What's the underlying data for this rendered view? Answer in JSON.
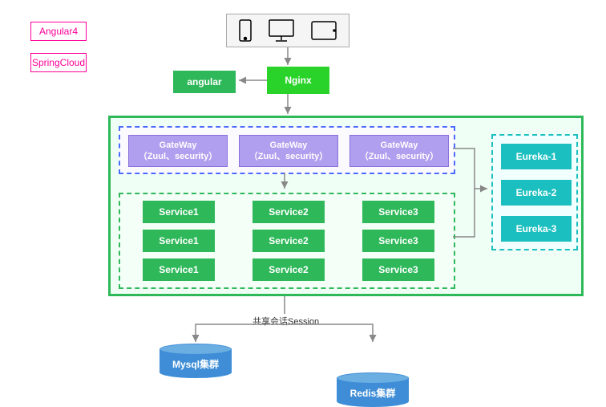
{
  "legend": {
    "angular4": "Angular4",
    "spring": "SpringCloud"
  },
  "top": {
    "angular": "angular",
    "nginx": "Nginx"
  },
  "container": {
    "gateway": {
      "label": "GateWay",
      "sublabel": "（Zuul、security）"
    },
    "services": {
      "s1": "Service1",
      "s2": "Service2",
      "s3": "Service3"
    },
    "eureka": {
      "e1": "Eureka-1",
      "e2": "Eureka-2",
      "e3": "Eureka-3"
    }
  },
  "session": {
    "label": "共享会话Session"
  },
  "db": {
    "mysql": "Mysql集群",
    "redis": "Redis集群"
  }
}
